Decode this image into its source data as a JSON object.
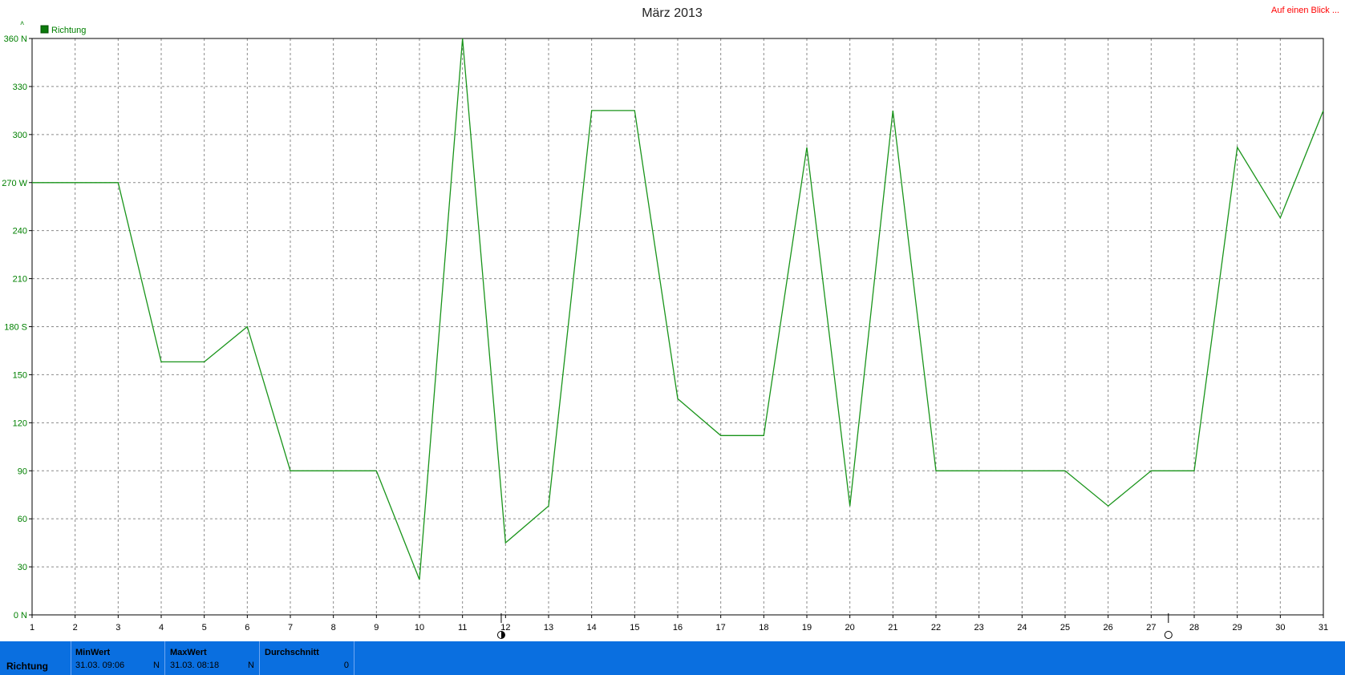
{
  "header": {
    "title": "März 2013",
    "top_link": "Auf einen Blick ..."
  },
  "colors": {
    "series": "#19941a",
    "axis_text": "#008000",
    "link": "#ff0000",
    "statbar": "#0a6fe0"
  },
  "chart_data": {
    "type": "line",
    "title": "März 2013",
    "x": [
      1,
      2,
      3,
      4,
      5,
      6,
      7,
      8,
      9,
      10,
      11,
      12,
      13,
      14,
      15,
      16,
      17,
      18,
      19,
      20,
      21,
      22,
      23,
      24,
      25,
      26,
      27,
      28,
      29,
      30,
      31
    ],
    "xlim": [
      1,
      31
    ],
    "ylim": [
      0,
      360
    ],
    "y_ticks": [
      {
        "value": 360,
        "label": "360 N"
      },
      {
        "value": 330,
        "label": "330"
      },
      {
        "value": 300,
        "label": "300"
      },
      {
        "value": 270,
        "label": "270 W"
      },
      {
        "value": 240,
        "label": "240"
      },
      {
        "value": 210,
        "label": "210"
      },
      {
        "value": 180,
        "label": "180 S"
      },
      {
        "value": 150,
        "label": "150"
      },
      {
        "value": 120,
        "label": "120"
      },
      {
        "value": 90,
        "label": "90"
      },
      {
        "value": 60,
        "label": "60"
      },
      {
        "value": 30,
        "label": "30"
      },
      {
        "value": 0,
        "label": "0 N"
      }
    ],
    "x_tick_labels": [
      "1",
      "2",
      "3",
      "4",
      "5",
      "6",
      "7",
      "8",
      "9",
      "10",
      "11",
      "12",
      "13",
      "14",
      "15",
      "16",
      "17",
      "18",
      "19",
      "20",
      "21",
      "22",
      "23",
      "24",
      "25",
      "26",
      "27",
      "28",
      "29",
      "30",
      "31"
    ],
    "grid": true,
    "legend_position": "top-left",
    "series": [
      {
        "name": "Richtung",
        "values": [
          270,
          270,
          270,
          158,
          158,
          180,
          90,
          90,
          90,
          22,
          360,
          45,
          68,
          315,
          315,
          135,
          112,
          112,
          292,
          68,
          315,
          90,
          90,
          90,
          90,
          68,
          90,
          90,
          292,
          248,
          315
        ]
      }
    ],
    "moon_markers": [
      {
        "x": 11.9,
        "phase": "half-moon"
      },
      {
        "x": 27.4,
        "phase": "full-moon"
      }
    ]
  },
  "statbar": {
    "row_label": "Richtung",
    "columns": [
      {
        "header": "MinWert",
        "value": "31.03.  09:06",
        "unit": "N"
      },
      {
        "header": "MaxWert",
        "value": "31.03.  08:18",
        "unit": "N"
      },
      {
        "header": "Durchschnitt",
        "value": "",
        "unit": "0"
      }
    ]
  }
}
